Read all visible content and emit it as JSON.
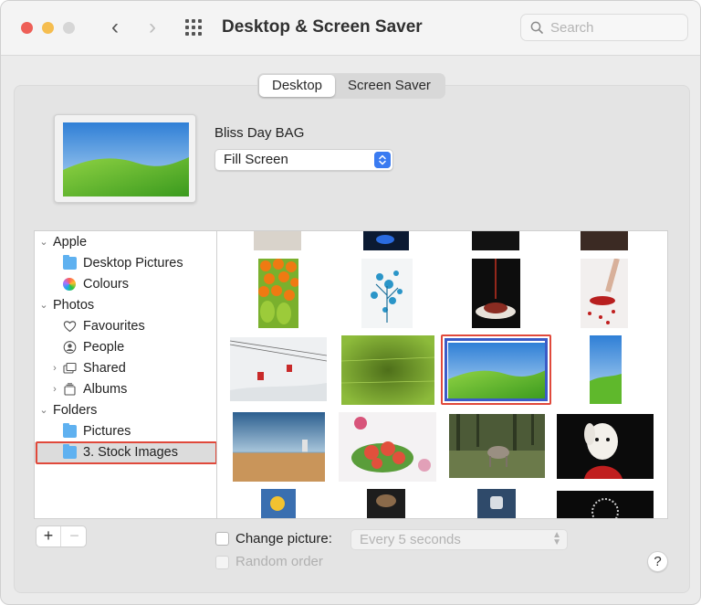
{
  "window": {
    "title": "Desktop & Screen Saver",
    "search_placeholder": "Search"
  },
  "tabs": [
    {
      "label": "Desktop",
      "active": true
    },
    {
      "label": "Screen Saver",
      "active": false
    }
  ],
  "current_background": {
    "name": "Bliss Day BAG",
    "fit_mode": "Fill Screen"
  },
  "sources": {
    "groups": [
      {
        "label": "Apple",
        "items": [
          {
            "label": "Desktop Pictures",
            "icon": "folder-icon"
          },
          {
            "label": "Colours",
            "icon": "colour-wheel-icon"
          }
        ]
      },
      {
        "label": "Photos",
        "items": [
          {
            "label": "Favourites",
            "icon": "heart-icon"
          },
          {
            "label": "People",
            "icon": "person-icon"
          },
          {
            "label": "Shared",
            "icon": "shared-album-icon"
          },
          {
            "label": "Albums",
            "icon": "albums-icon"
          }
        ]
      },
      {
        "label": "Folders",
        "items": [
          {
            "label": "Pictures",
            "icon": "folder-icon"
          },
          {
            "label": "3. Stock Images",
            "icon": "folder-icon",
            "selected": true
          }
        ]
      }
    ]
  },
  "bottom": {
    "add_label": "+",
    "remove_label": "−",
    "change_picture_label": "Change picture:",
    "change_picture_checked": false,
    "interval_value": "Every 5 seconds",
    "random_order_label": "Random order",
    "random_order_checked": false,
    "help_label": "?"
  },
  "colors": {
    "accent": "#3a7bf1",
    "highlight": "#e0493b",
    "selection_border": "#3b5bc7"
  }
}
